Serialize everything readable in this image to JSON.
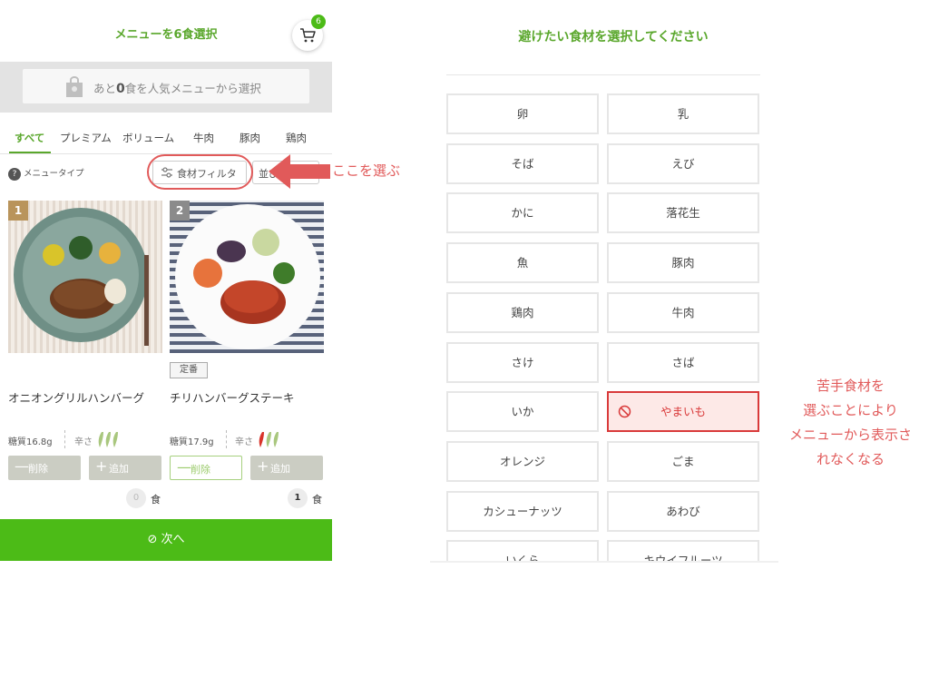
{
  "left": {
    "title": "メニューを6食選択",
    "cart_badge": "6",
    "popular_prefix": "あと",
    "popular_count": "0",
    "popular_suffix": "食を人気メニューから選択",
    "tabs": [
      "すべて",
      "プレミアム",
      "ボリューム",
      "牛肉",
      "豚肉",
      "鶏肉"
    ],
    "menu_type_icon": "?",
    "menu_type_label": "メニュータイプ",
    "filter_label": "食材フィルタ",
    "sort_label": "並び",
    "cards": [
      {
        "number": "1",
        "name": "オニオングリルハンバーグ",
        "sugar": "糖質16.8g",
        "spice_label": "辛さ",
        "spice_level": 0,
        "remove_label": "削除",
        "add_label": "追加",
        "count": "0",
        "unit": "食"
      },
      {
        "number": "2",
        "tag": "定番",
        "name": "チリハンバーグステーキ",
        "sugar": "糖質17.9g",
        "spice_label": "辛さ",
        "spice_level": 1,
        "remove_label": "削除",
        "add_label": "追加",
        "count": "1",
        "unit": "食"
      }
    ],
    "next_label": "次へ"
  },
  "annotations": {
    "choose_here": "ここを選ぶ",
    "right_note": [
      "苦手食材を",
      "選ぶことにより",
      "メニューから表示さ",
      "れなくなる"
    ]
  },
  "right": {
    "title": "避けたい食材を選択してください",
    "ingredients": [
      {
        "label": "卵",
        "selected": false
      },
      {
        "label": "乳",
        "selected": false
      },
      {
        "label": "そば",
        "selected": false
      },
      {
        "label": "えび",
        "selected": false
      },
      {
        "label": "かに",
        "selected": false
      },
      {
        "label": "落花生",
        "selected": false
      },
      {
        "label": "魚",
        "selected": false
      },
      {
        "label": "豚肉",
        "selected": false
      },
      {
        "label": "鶏肉",
        "selected": false
      },
      {
        "label": "牛肉",
        "selected": false
      },
      {
        "label": "さけ",
        "selected": false
      },
      {
        "label": "さば",
        "selected": false
      },
      {
        "label": "いか",
        "selected": false
      },
      {
        "label": "やまいも",
        "selected": true
      },
      {
        "label": "オレンジ",
        "selected": false
      },
      {
        "label": "ごま",
        "selected": false
      },
      {
        "label": "カシューナッツ",
        "selected": false
      },
      {
        "label": "あわび",
        "selected": false
      },
      {
        "label": "いくら",
        "selected": false
      },
      {
        "label": "キウイフルーツ",
        "selected": false
      }
    ]
  },
  "colors": {
    "brand_green": "#4cbb17",
    "title_green": "#5aa72c",
    "annotation_red": "#e15a5a",
    "selected_red": "#d93a3a",
    "selected_bg": "#fde9e7"
  }
}
